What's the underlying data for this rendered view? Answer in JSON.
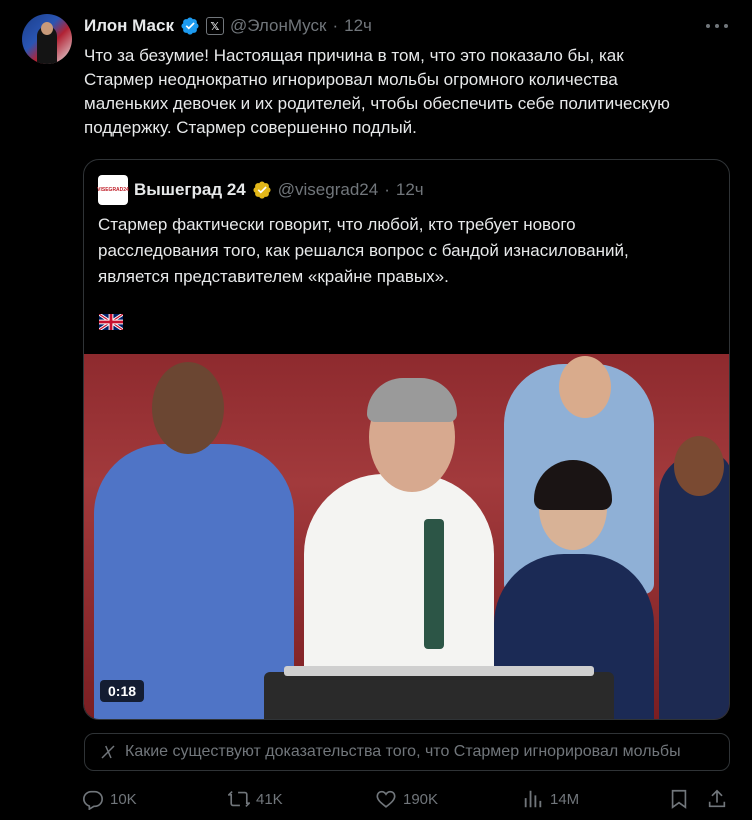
{
  "post": {
    "author_name": "Илон Маск",
    "x_badge": "𝕏",
    "handle": "@ЭлонМуск",
    "separator": "·",
    "time": "12ч",
    "text_lines": [
      "Что за безумие! Настоящая причина в том, что это показало бы, как",
      "Стармер неоднократно игнорировал мольбы огромного количества",
      "маленьких девочек и их родителей, чтобы обеспечить себе политическую",
      "поддержку. Стармер совершенно подлый."
    ]
  },
  "quote": {
    "author_name": "Вышеград 24",
    "logo_text": "VISEGRAD24",
    "handle": "@visegrad24",
    "separator": "·",
    "time": "12ч",
    "text_lines": [
      "Стармер фактически говорит, что любой, кто требует нового",
      "расследования того, как решался вопрос с бандой изнасилований,",
      "является представителем «крайне правых»."
    ],
    "flag_icon": "uk-flag-icon",
    "video_duration": "0:18"
  },
  "grok_prompt": "Какие существуют доказательства того, что Стармер игнорировал мольбы",
  "actions": {
    "replies": "10K",
    "reposts": "41K",
    "likes": "190K",
    "views": "14M"
  },
  "colors": {
    "background": "#000000",
    "text_primary": "#e7e9ea",
    "text_secondary": "#71767b",
    "border": "#2f3336",
    "verified_blue": "#1d9bf0",
    "verified_gold": "#e2b719"
  }
}
